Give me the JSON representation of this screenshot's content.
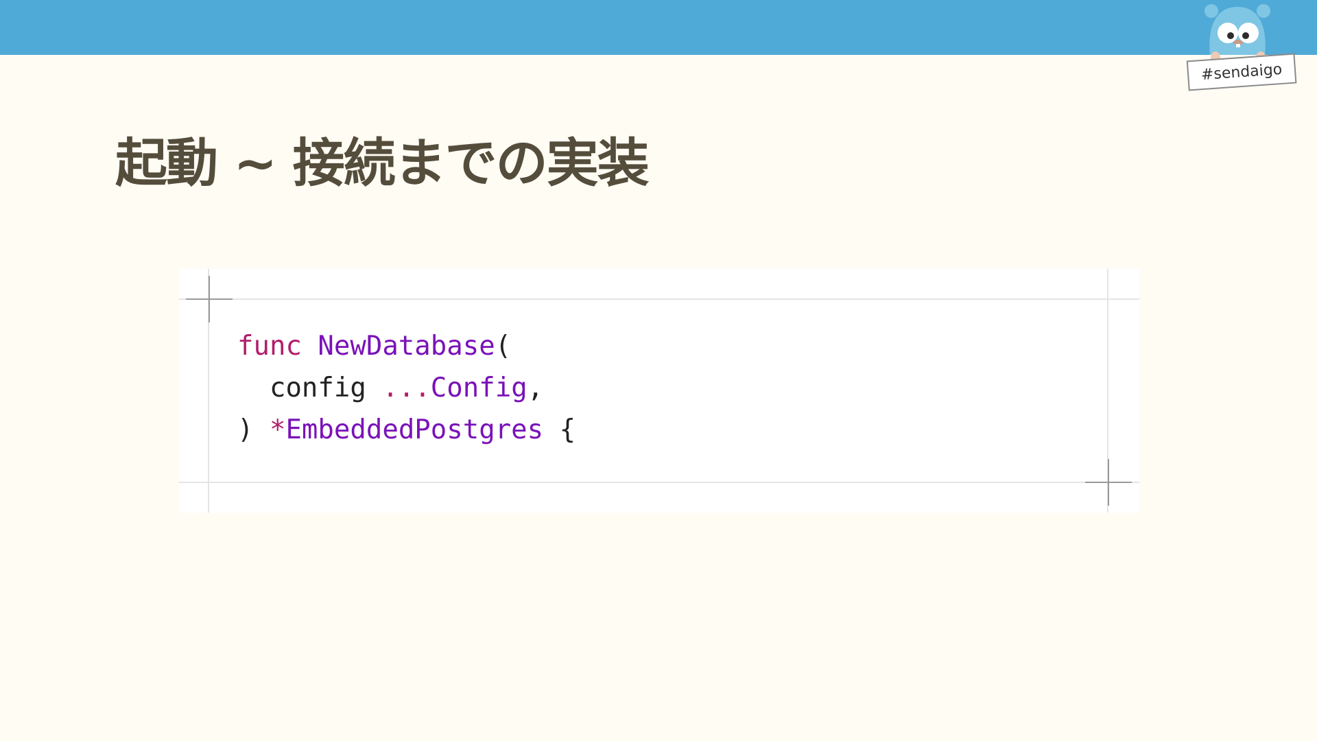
{
  "header": {
    "bar_color": "#4faad7",
    "hashtag": "#sendaigo",
    "mascot_icon": "gopher-mascot-icon"
  },
  "slide": {
    "title": "起動 ~ 接続までの実装",
    "background": "#fffcf4",
    "title_color": "#554d3c"
  },
  "code": {
    "language": "go",
    "lines": [
      {
        "keyword": "func",
        "space1": " ",
        "name": "NewDatabase",
        "paren": "("
      },
      {
        "indent": "  ",
        "param": "config",
        "space": " ",
        "variadic": "...",
        "type": "Config",
        "comma": ","
      },
      {
        "close": ") ",
        "star": "*",
        "type": "EmbeddedPostgres",
        "brace": " {"
      }
    ],
    "colors": {
      "keyword": "#b01f6a",
      "identifier": "#7a12b8",
      "plain": "#222222"
    }
  }
}
